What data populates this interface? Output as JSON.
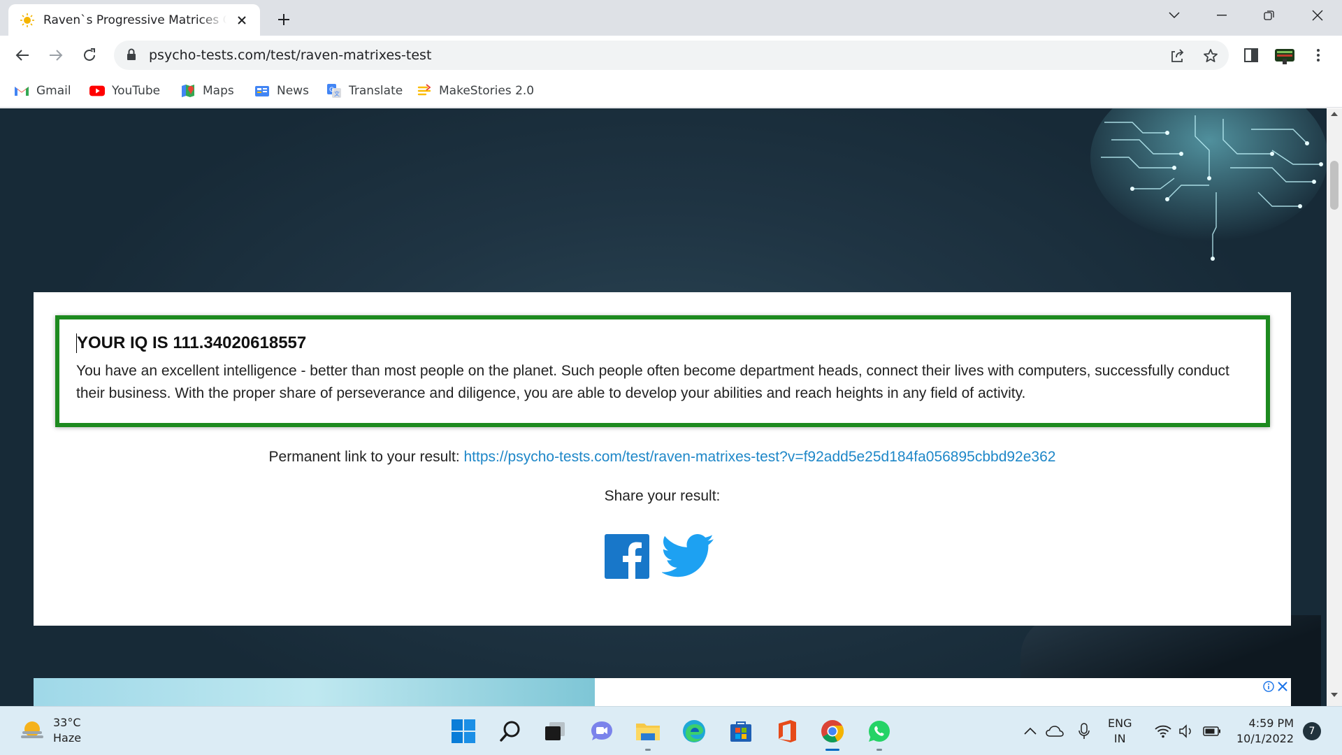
{
  "browser": {
    "tab_title": "Raven`s Progressive Matrices Online",
    "url": "psycho-tests.com/test/raven-matrixes-test"
  },
  "bookmarks": [
    {
      "label": "Gmail",
      "icon": "gmail-icon"
    },
    {
      "label": "YouTube",
      "icon": "youtube-icon"
    },
    {
      "label": "Maps",
      "icon": "maps-icon"
    },
    {
      "label": "News",
      "icon": "news-icon"
    },
    {
      "label": "Translate",
      "icon": "translate-icon"
    },
    {
      "label": "MakeStories 2.0",
      "icon": "makestories-icon"
    }
  ],
  "result": {
    "iq_heading": "YOUR IQ IS 111.34020618557",
    "description": "You have an excellent intelligence - better than most people on the planet. Such people often become department heads, connect their lives with computers, successfully conduct their business. With the proper share of perseverance and diligence, you are able to develop your abilities and reach heights in any field of activity.",
    "permanent_link_label": "Permanent link to your result: ",
    "permanent_link_url": "https://psycho-tests.com/test/raven-matrixes-test?v=f92add5e25d184fa056895cbbd92e362",
    "share_label": "Share your result:",
    "share_networks": [
      "facebook-icon",
      "twitter-icon"
    ]
  },
  "colors": {
    "result_border": "#1d8a1f",
    "link": "#1e87c8",
    "page_background": "#1f3443"
  },
  "taskbar": {
    "weather_temp": "33°C",
    "weather_desc": "Haze",
    "lang_line1": "ENG",
    "lang_line2": "IN",
    "time": "4:59 PM",
    "date": "10/1/2022",
    "notification_count": "7"
  }
}
